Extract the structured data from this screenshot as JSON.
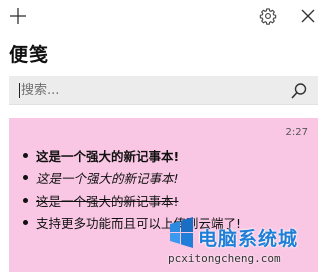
{
  "toolbar": {
    "add_icon": "plus-icon",
    "settings_icon": "gear-icon",
    "close_icon": "close-icon"
  },
  "app": {
    "title": "便笺"
  },
  "search": {
    "value": "",
    "placeholder": "搜索...",
    "icon": "search-icon"
  },
  "note": {
    "background_color": "#f9c7e4",
    "time": "2:27",
    "lines": [
      {
        "text": "这是一个强大的新记事本!",
        "style": "bold"
      },
      {
        "text": "这是一个强大的新记事本!",
        "style": "italic"
      },
      {
        "text": "这是一个强大的新记事本!",
        "style": "strikethrough"
      },
      {
        "text": "支持更多功能而且可以上传到云端了!",
        "style": "normal"
      }
    ]
  },
  "watermark": {
    "text": "电脑系统城",
    "subtext": "pcxitongcheng.com",
    "color": "#1f7fd8"
  }
}
